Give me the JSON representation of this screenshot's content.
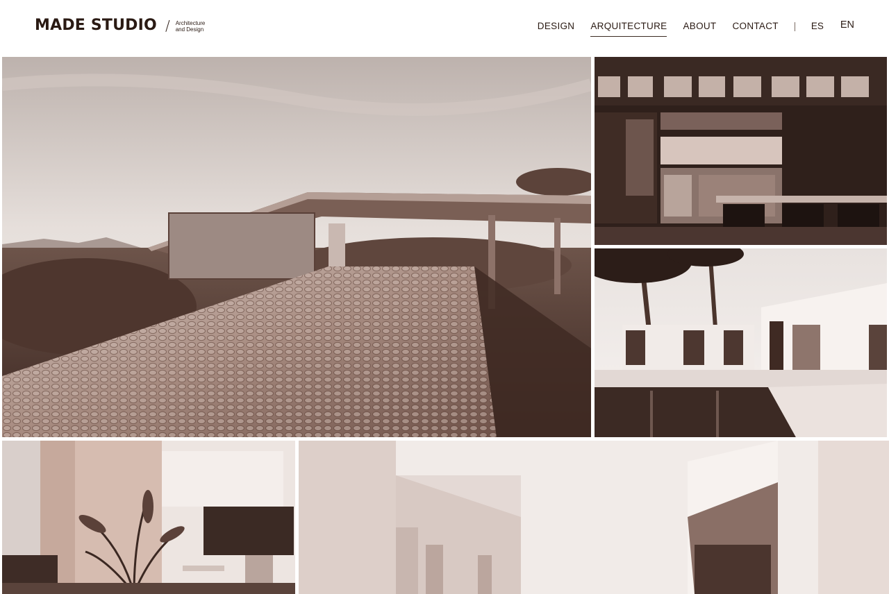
{
  "brand": {
    "name": "MADE STUDIO",
    "slash": "/",
    "tagline_line1": "Architecture",
    "tagline_line2": "and Design"
  },
  "nav": {
    "items": [
      {
        "label": "DESIGN",
        "active": false
      },
      {
        "label": "ARQUITECTURE",
        "active": true
      },
      {
        "label": "ABOUT",
        "active": false
      },
      {
        "label": "CONTACT",
        "active": false
      }
    ],
    "separator": "|",
    "languages": [
      "ES",
      "EN"
    ]
  },
  "gallery": {
    "tiles": [
      {
        "id": "pavilion",
        "subject": "pebble-roof-pavilion-photo"
      },
      {
        "id": "bar",
        "subject": "bar-interior-photo"
      },
      {
        "id": "house",
        "subject": "white-house-pool-photo"
      },
      {
        "id": "lounge",
        "subject": "lounge-interior-photo"
      },
      {
        "id": "interior",
        "subject": "white-interior-photo"
      }
    ]
  },
  "colors": {
    "text": "#2a1a13",
    "tone_dark": "#3a2620",
    "tone_mid": "#8b7063",
    "tone_light": "#e9dfda"
  }
}
